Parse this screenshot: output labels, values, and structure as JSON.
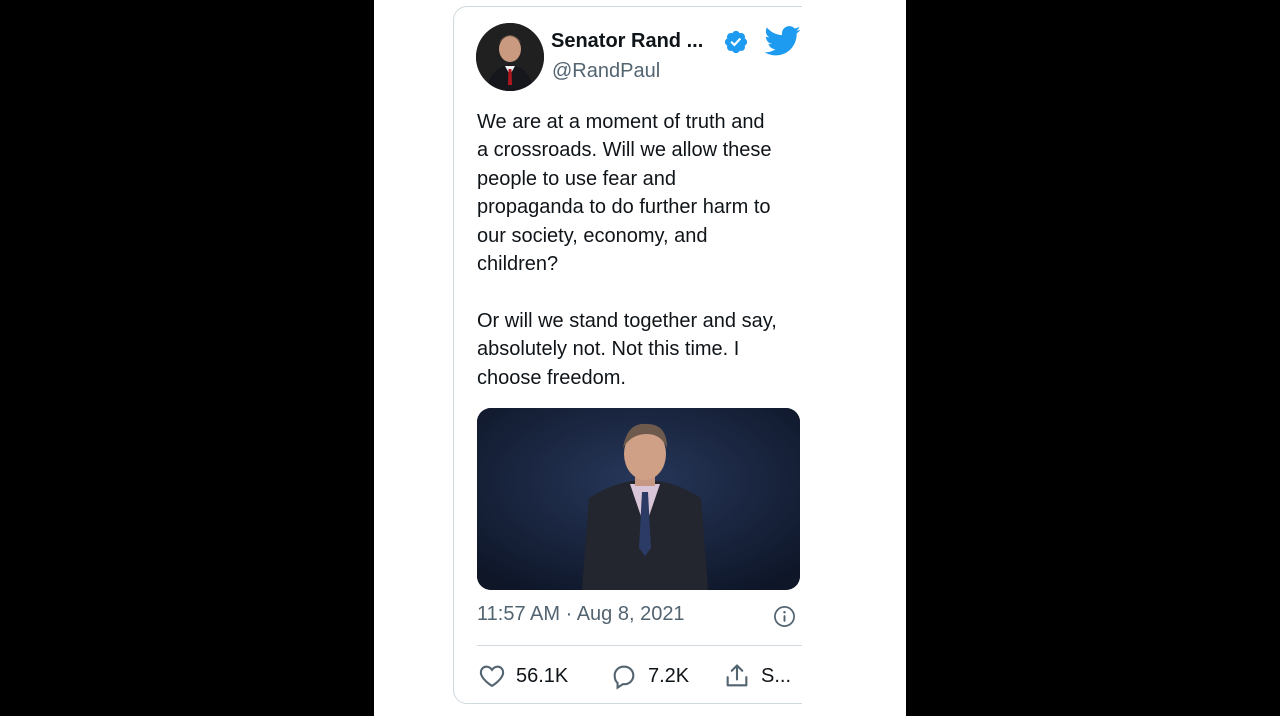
{
  "tweet": {
    "display_name": "Senator Rand ...",
    "handle": "@RandPaul",
    "paragraph_1": "We are at a moment of truth and\na crossroads. Will we allow these\npeople to use fear and\npropaganda to do further harm to\nour society, economy, and\nchildren?",
    "paragraph_2": "Or will we stand together and say,\nabsolutely not. Not this time. I\nchoose freedom.",
    "timestamp": "11:57 AM · Aug 8, 2021",
    "likes": "56.1K",
    "replies": "7.2K",
    "share_label": "S..."
  },
  "icons": {
    "verified": "verified-badge-icon",
    "logo": "twitter-bird-icon",
    "info": "info-icon",
    "like": "heart-icon",
    "reply": "speech-bubble-icon",
    "share": "share-upload-icon"
  },
  "colors": {
    "twitter_blue": "#1d9bf0",
    "text_primary": "#0f1419",
    "text_secondary": "#536471",
    "border": "#cfd9de",
    "video_background": "#14213a"
  }
}
